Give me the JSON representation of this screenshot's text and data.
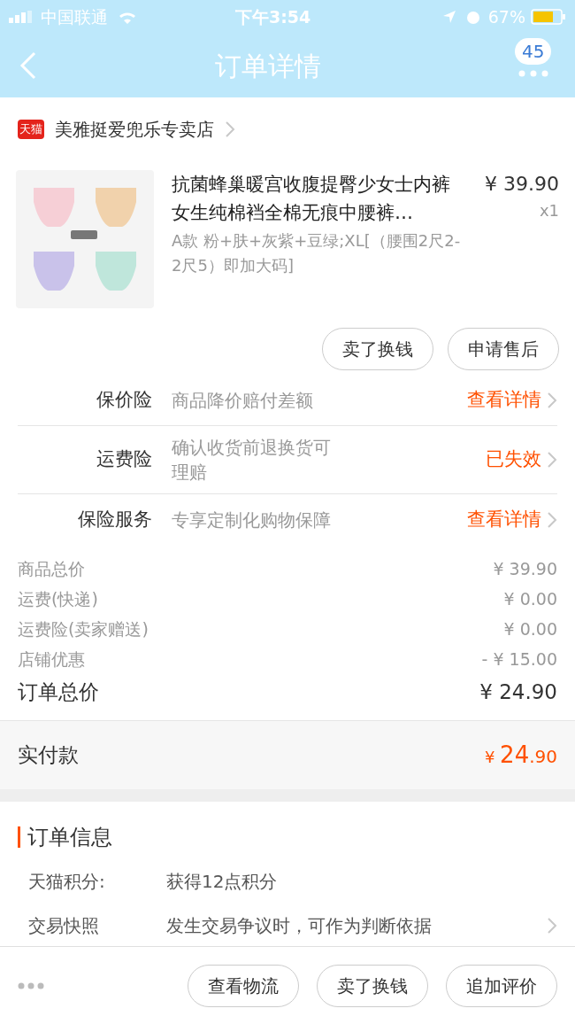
{
  "status_bar": {
    "carrier": "中国联通",
    "time": "下午3:54",
    "battery": "67%"
  },
  "nav": {
    "title": "订单详情",
    "badge": "45"
  },
  "store": {
    "logo": "天猫",
    "name": "美雅挺爱兜乐专卖店"
  },
  "product": {
    "title": "抗菌蜂巢暖宫收腹提臀少女士内裤女生纯棉裆全棉无痕中腰裤…",
    "sku": "A款 粉+肤+灰紫+豆绿;XL[（腰围2尺2-2尺5）即加大码]",
    "price": "¥ 39.90",
    "qty": "x1",
    "buttons": [
      "卖了换钱",
      "申请售后"
    ]
  },
  "services": [
    {
      "label": "保价险",
      "desc": "商品降价赔付差额",
      "action": "查看详情"
    },
    {
      "label": "运费险",
      "desc": "确认收货前退换货可理赔",
      "action": "已失效"
    },
    {
      "label": "保险服务",
      "desc": "专享定制化购物保障",
      "action": "查看详情"
    }
  ],
  "summary": [
    {
      "label": "商品总价",
      "value": "¥ 39.90"
    },
    {
      "label": "运费(快递)",
      "value": "¥ 0.00"
    },
    {
      "label": "运费险(卖家赠送)",
      "value": "¥ 0.00"
    },
    {
      "label": "店铺优惠",
      "value": "- ¥ 15.00"
    }
  ],
  "total": {
    "label": "订单总价",
    "value": "¥ 24.90"
  },
  "paid": {
    "label": "实付款",
    "currency": "¥",
    "integer": "24",
    "decimal": ".90"
  },
  "order_info": {
    "title": "订单信息",
    "rows": [
      {
        "label": "天猫积分:",
        "value": "获得12点积分",
        "chevron": false
      },
      {
        "label": "交易快照",
        "value": "发生交易争议时，可作为判断依据",
        "chevron": true
      }
    ]
  },
  "bottom_bar": {
    "buttons": [
      "查看物流",
      "卖了换钱",
      "追加评价"
    ]
  }
}
